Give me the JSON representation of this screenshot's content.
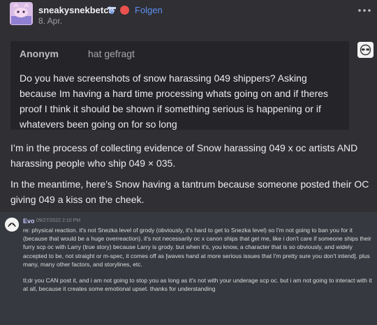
{
  "post": {
    "username": "sneakysnekbetch",
    "follow_label": "Folgen",
    "date": "8. Apr.",
    "more_icon": "more-horizontal-icon"
  },
  "ask": {
    "asker": "Anonym",
    "verb": "hat gefragt",
    "question": "Do you have screenshots of snow harassing 049 shippers? Asking because Im having a hard time processing whats going on and if theres proof I think it should be shown if something serious is happening or if whatevers been going on for so long"
  },
  "body": {
    "paragraph_1": "I’m in the process of collecting evidence of Snow harassing 049 x oc artists AND harassing people who ship 049 × 035.",
    "paragraph_2": "In the meantime, here’s Snow having a tantrum because someone posted their OC giving 049 a kiss on the cheek."
  },
  "embed": {
    "user": "Evo",
    "timestamp": "09/27/2022 2:10 PM",
    "message_1": "re: physical reaction. it's not Snezka level of grody (obviously, it's hard to get to Snezka level) so I'm not going to ban you for it (because that would be a huge overreaction). it's not necessarily oc x canon ships that get me, like i don't care if someone ships their furry scp oc with Larry (true story) because Larry is grody. but when it's, you know, a character that is so obviously, and widely accepted to be, not straight or m-spec, it comes off as [waves hand at more serious issues that I'm pretty sure you don't intend]. plus many, many other factors, and storylines, etc.",
    "message_2": "tl;dr you CAN post it, and i am not going to stop you as long as it's not with your underage scp oc. but i am not going to interact with it at all, because it creates some emotional upset. thanks for understanding"
  },
  "colors": {
    "background": "#302f34",
    "ask_background": "#252429",
    "embed_background": "#36393f",
    "follow": "#5e8ff0",
    "embed_username": "#c8c7ff"
  }
}
